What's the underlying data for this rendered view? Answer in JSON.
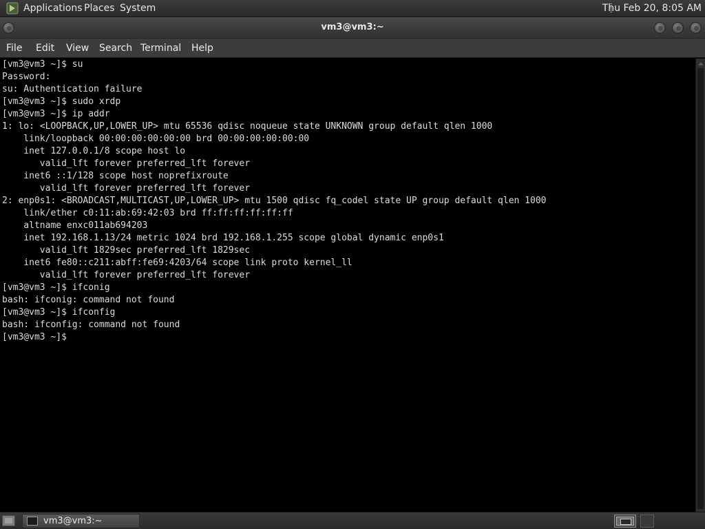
{
  "top_panel": {
    "applications": "Applications",
    "places": "Places",
    "system": "System",
    "clock": "Thu Feb 20,  8:05 AM",
    "applications_icon": "gnome-foot-icon"
  },
  "window": {
    "title": "vm3@vm3:~"
  },
  "menubar": {
    "file": "File",
    "edit": "Edit",
    "view": "View",
    "search": "Search",
    "terminal": "Terminal",
    "help": "Help"
  },
  "terminal": {
    "lines": [
      "[vm3@vm3 ~]$ su",
      "Password:",
      "su: Authentication failure",
      "[vm3@vm3 ~]$ sudo xrdp",
      "[vm3@vm3 ~]$ ip addr",
      "1: lo: <LOOPBACK,UP,LOWER_UP> mtu 65536 qdisc noqueue state UNKNOWN group default qlen 1000",
      "    link/loopback 00:00:00:00:00:00 brd 00:00:00:00:00:00",
      "    inet 127.0.0.1/8 scope host lo",
      "       valid_lft forever preferred_lft forever",
      "    inet6 ::1/128 scope host noprefixroute",
      "       valid_lft forever preferred_lft forever",
      "2: enp0s1: <BROADCAST,MULTICAST,UP,LOWER_UP> mtu 1500 qdisc fq_codel state UP group default qlen 1000",
      "    link/ether c0:11:ab:69:42:03 brd ff:ff:ff:ff:ff:ff",
      "    altname enxc011ab694203",
      "    inet 192.168.1.13/24 metric 1024 brd 192.168.1.255 scope global dynamic enp0s1",
      "       valid_lft 1829sec preferred_lft 1829sec",
      "    inet6 fe80::c211:abff:fe69:4203/64 scope link proto kernel_ll",
      "       valid_lft forever preferred_lft forever",
      "[vm3@vm3 ~]$ ifconig",
      "bash: ifconig: command not found",
      "[vm3@vm3 ~]$ ifconfig",
      "bash: ifconfig: command not found",
      "[vm3@vm3 ~]$"
    ]
  },
  "taskbar": {
    "window_button": "vm3@vm3:~"
  },
  "colors": {
    "terminal_bg": "#000000",
    "terminal_fg": "#dcdcdc",
    "panel_bg": "#333333"
  }
}
